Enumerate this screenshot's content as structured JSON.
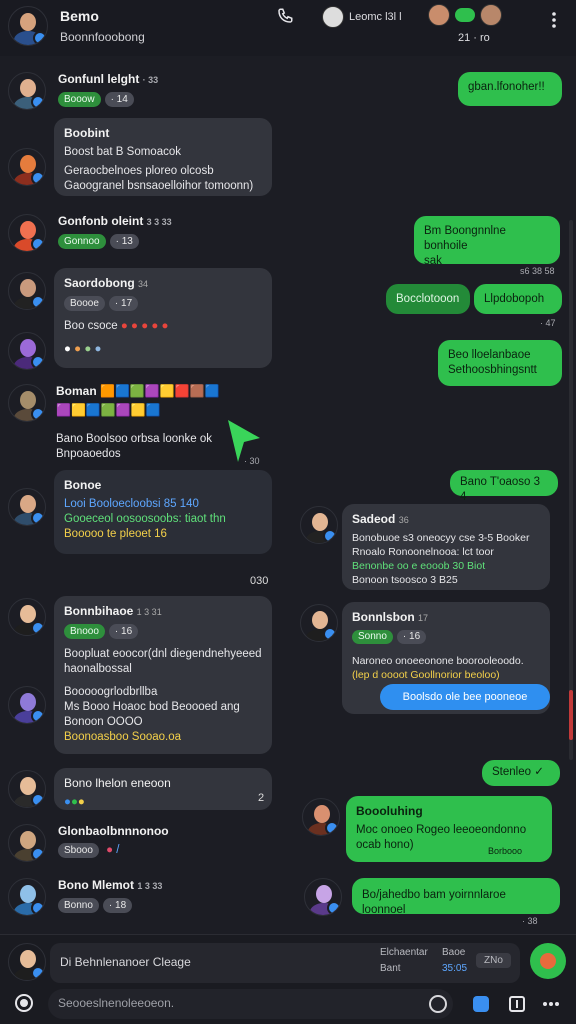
{
  "header": {
    "title": "Bemo",
    "subtitle": "Boonnfooobong",
    "call_status": "Leomc l3l l",
    "count": "21 · ro"
  },
  "messages": [
    {
      "id": "m1",
      "side": "in",
      "name": "Gonfunl lelght",
      "time": "· 33",
      "chips": [
        "Booow",
        "· 14"
      ]
    },
    {
      "id": "m2",
      "side": "in",
      "name": "Boobint",
      "lines": [
        "Boost bat B Somoacok",
        "Geraocbelnoes ploreo olcosb",
        "Gaoogranel bsnsaoelloihor tomoonn)"
      ]
    },
    {
      "id": "m3",
      "side": "in",
      "name": "Gonfonb oleint",
      "time": "3 3 33",
      "chips": [
        "Gonnoo",
        "· 13"
      ]
    },
    {
      "id": "m4",
      "side": "out",
      "lines": [
        "gban.lfonoher!!"
      ]
    },
    {
      "id": "m5",
      "side": "out",
      "lines": [
        "Bm Boongnnlne bonhoile",
        "sak"
      ],
      "time": "s6 38 58"
    },
    {
      "id": "m6",
      "side": "in",
      "name": "Saordobong",
      "time": "34",
      "chips": [
        "Boooe",
        "· 17"
      ],
      "line2": "Boo csoce"
    },
    {
      "id": "m7",
      "side": "out-dark",
      "lines": [
        "Bocclotooon"
      ]
    },
    {
      "id": "m8",
      "side": "out",
      "lines": [
        "Llpdobopoh"
      ],
      "time": "· 47"
    },
    {
      "id": "m9",
      "side": "out",
      "lines": [
        "Beo lloelanbaoe",
        "Sethoosbhingsntt"
      ]
    },
    {
      "id": "m10",
      "side": "in",
      "name": "Boman",
      "lines": [
        "Bano Boolsoo orbsa loonke ok",
        "Bnpoaoedos"
      ],
      "time": "· 30"
    },
    {
      "id": "m11",
      "side": "out",
      "lines": [
        "Bano T'oaoso 3 4"
      ]
    },
    {
      "id": "m12",
      "side": "in",
      "name": "Bonoe",
      "lines": [
        "Looi   Booloecloobsi 85 140",
        "Gooeceol oosoosoobs: tiaot thn",
        "Booooo te pleoet 16"
      ]
    },
    {
      "id": "m13",
      "side": "in",
      "name": "Sadeod",
      "time": "36",
      "lines": [
        "Bonobuoe s3 oneocyy cse 3-5 Booker",
        "Rnoalo Ronoonelnooa: lct toor",
        "Benonbe oo e eooob 30 Biot",
        "Bonoon tsoosco 3 B25"
      ]
    },
    {
      "id": "m14",
      "side": "in",
      "name": "Bonnbihaoe",
      "time": "1 3 31",
      "chips": [
        "Bnooo",
        "· 16"
      ],
      "lines": [
        "Boopluat eoocor(dnl diegendnehyeeed",
        "haonalbossal",
        "Booooogrlodbrllba",
        "Ms Booo Hoaoc bod Beoooed ang",
        "Bonoon  OOOO",
        "Boonoasboo Sooao.oa"
      ]
    },
    {
      "id": "m15",
      "side": "in",
      "name": "Bonnlsbon",
      "time": "17",
      "chips": [
        "Sonno",
        "· 16"
      ],
      "lines": [
        "Naroneo onoeeonone boorooleoodo.",
        "(lep d oooot Goollnorior beoloo)"
      ]
    },
    {
      "id": "m16",
      "side": "reply",
      "lines": [
        "Boolsdo ole bee pooneoe"
      ]
    },
    {
      "id": "m17",
      "side": "in",
      "name": "Bono lhelon eneoon",
      "time": "2"
    },
    {
      "id": "m18",
      "side": "out",
      "lines": [
        "Stenleo"
      ]
    },
    {
      "id": "m19",
      "side": "in",
      "name": "Glonbaolbnnnonoo",
      "chips": [
        "Sbooo"
      ]
    },
    {
      "id": "m20",
      "side": "out",
      "name": "Boooluhing",
      "lines": [
        "Moc onoeo Rogeo leeoeondonno",
        "ocab hono)"
      ],
      "time": "Borbooo"
    },
    {
      "id": "m21",
      "side": "in",
      "name": "Bono Mlemot",
      "time": "1 3 33",
      "chips": [
        "Bonno",
        "· 18"
      ]
    },
    {
      "id": "m22",
      "side": "out",
      "lines": [
        "Bo/jahedbo bam yoirnnlaroe loonnoel"
      ],
      "time": "· 38"
    }
  ],
  "composer": {
    "label": "Di Behnlenanoer Cleage",
    "meta_a": "Elchaentar",
    "meta_a2": "Bant",
    "meta_b": "Baoe",
    "meta_b2": "35:05",
    "meta_c": "ZNo",
    "search_placeholder": "Seooeslnenoleeoeon."
  },
  "colors": {
    "accent": "#2fbf4d",
    "incoming": "#33353d",
    "background": "#1c1d24",
    "reply": "#2f8ff0"
  },
  "icons": [
    "phone-icon",
    "more-icon",
    "mic-icon",
    "emoji-icon",
    "attach-icon",
    "send-icon",
    "camera-icon"
  ]
}
